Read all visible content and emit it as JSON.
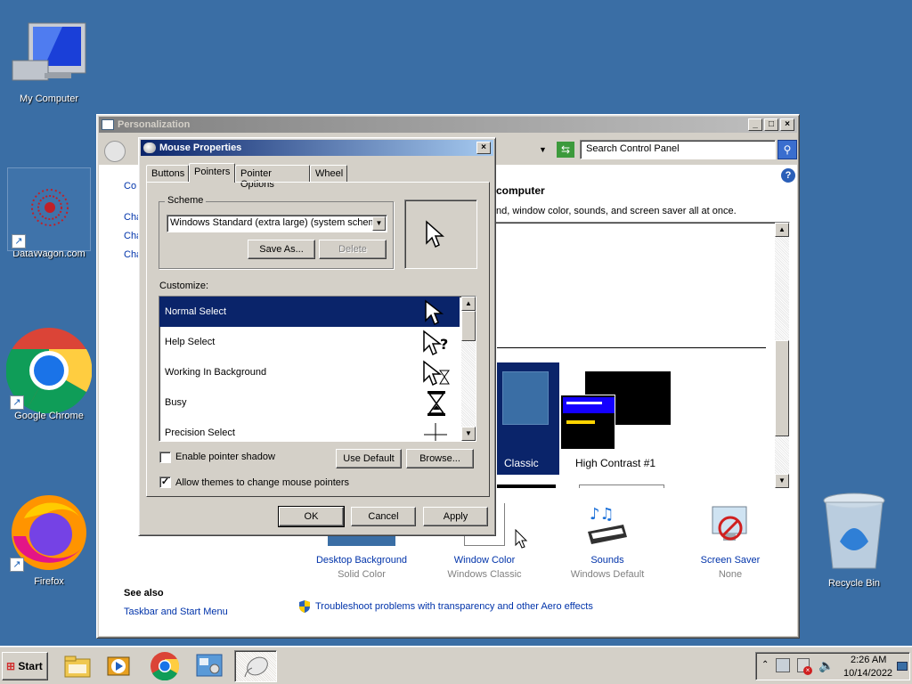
{
  "desktop": {
    "icons": [
      {
        "label": "My Computer"
      },
      {
        "label": "DataWagon.com"
      },
      {
        "label": "Google Chrome"
      },
      {
        "label": "Firefox"
      },
      {
        "label": "Recycle Bin"
      }
    ]
  },
  "personalization": {
    "title": "Personalization",
    "search_placeholder": "Search Control Panel",
    "heading_partial": "computer",
    "desc_partial": "nd, window color, sounds, and screen saver all at once.",
    "left_partials": [
      "Co",
      "Cha",
      "Cha",
      "Cha"
    ],
    "themes": [
      {
        "label": "Classic"
      },
      {
        "label": "High Contrast #1"
      }
    ],
    "items": [
      {
        "title": "Desktop Background",
        "sub": "Solid Color"
      },
      {
        "title": "Window Color",
        "sub": "Windows Classic"
      },
      {
        "title": "Sounds",
        "sub": "Windows Default"
      },
      {
        "title": "Screen Saver",
        "sub": "None"
      }
    ],
    "see_also": "See also",
    "taskbar_link": "Taskbar and Start Menu",
    "troubleshoot": "Troubleshoot problems with transparency and other Aero effects"
  },
  "mouse": {
    "title": "Mouse Properties",
    "tabs": [
      "Buttons",
      "Pointers",
      "Pointer Options",
      "Wheel"
    ],
    "scheme_label": "Scheme",
    "scheme_value": "Windows Standard (extra large) (system scheme",
    "save_as": "Save As...",
    "delete": "Delete",
    "customize_label": "Customize:",
    "pointers": [
      {
        "label": "Normal Select"
      },
      {
        "label": "Help Select"
      },
      {
        "label": "Working In Background"
      },
      {
        "label": "Busy"
      },
      {
        "label": "Precision Select"
      }
    ],
    "enable_shadow": "Enable pointer shadow",
    "use_default": "Use Default",
    "browse": "Browse...",
    "allow_themes": "Allow themes to change mouse pointers",
    "ok": "OK",
    "cancel": "Cancel",
    "apply": "Apply"
  },
  "taskbar": {
    "start": "Start",
    "time": "2:26 AM",
    "date": "10/14/2022"
  }
}
